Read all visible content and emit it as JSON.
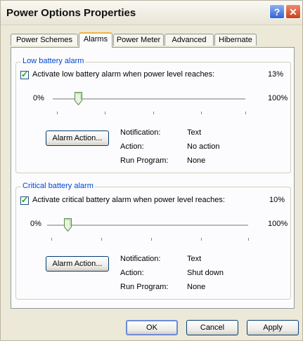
{
  "window": {
    "title": "Power Options Properties",
    "help_glyph": "?",
    "close_glyph": "✕"
  },
  "tabs": [
    "Power Schemes",
    "Alarms",
    "Power Meter",
    "Advanced",
    "Hibernate"
  ],
  "active_tab": "Alarms",
  "low": {
    "legend": "Low battery alarm",
    "checkbox_label": "Activate low battery alarm when power level reaches:",
    "checked": true,
    "value_text": "13%",
    "value": 13,
    "min_label": "0%",
    "max_label": "100%",
    "alarm_button": "Alarm Action...",
    "notification_label": "Notification:",
    "notification_value": "Text",
    "action_label": "Action:",
    "action_value": "No action",
    "run_program_label": "Run Program:",
    "run_program_value": "None"
  },
  "critical": {
    "legend": "Critical battery alarm",
    "checkbox_label": "Activate critical battery alarm when power level reaches:",
    "checked": true,
    "value_text": "10%",
    "value": 10,
    "min_label": "0%",
    "max_label": "100%",
    "alarm_button": "Alarm Action...",
    "notification_label": "Notification:",
    "notification_value": "Text",
    "action_label": "Action:",
    "action_value": "Shut down",
    "run_program_label": "Run Program:",
    "run_program_value": "None"
  },
  "buttons": {
    "ok": "OK",
    "cancel": "Cancel",
    "apply": "Apply"
  },
  "colors": {
    "group_title": "#0046d5",
    "tab_highlight": "#f0b53a",
    "close": "#c8421b",
    "help": "#2f63d8"
  }
}
